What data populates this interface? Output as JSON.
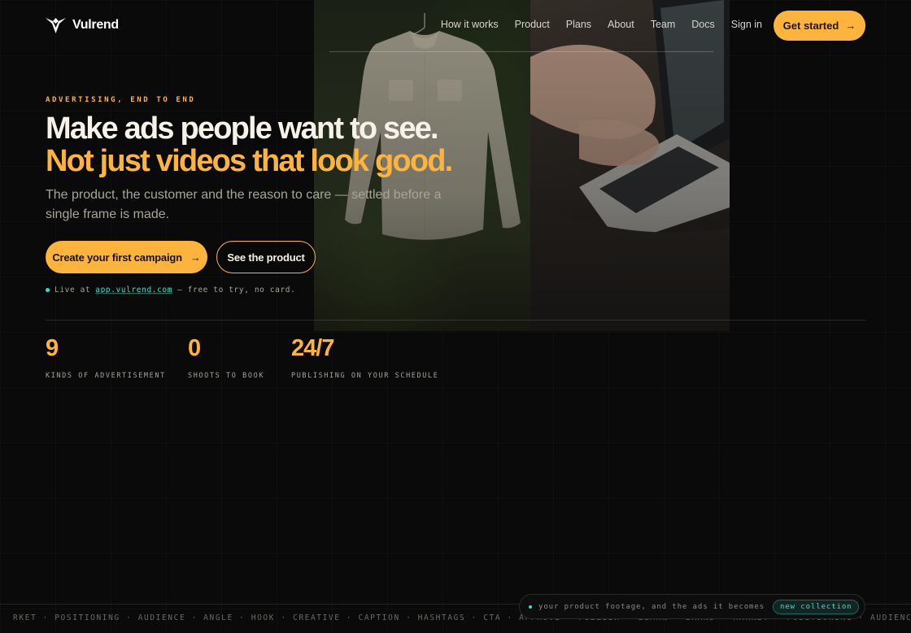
{
  "brand": {
    "name": "Vulrend",
    "logo_icon": "v-bird-logo"
  },
  "nav": {
    "links": [
      "How it works",
      "Product",
      "Plans",
      "About",
      "Team",
      "Docs",
      "Sign in"
    ],
    "cta_label": "Get started",
    "cta_icon": "arrow-right-icon"
  },
  "hero": {
    "eyebrow": "ADVERTISING, END TO END",
    "headline_line1": "Make ads people want to see.",
    "headline_line2": "Not just videos that look good.",
    "subtitle": "The product, the customer and the reason to care — settled before a single frame is made.",
    "primary_button": "Create your first campaign",
    "secondary_button": "See the product",
    "live_prefix": "Live at",
    "live_link": "app.vulrend.com",
    "live_suffix": "— free to try, no card."
  },
  "stats": [
    {
      "value": "9",
      "label": "KINDS OF ADVERTISEMENT"
    },
    {
      "value": "0",
      "label": "SHOOTS TO BOOK"
    },
    {
      "value": "24/7",
      "label": "PUBLISHING ON YOUR SCHEDULE"
    }
  ],
  "ticker": {
    "text": "RKET · POSITIONING · AUDIENCE · ANGLE · HOOK · CREATIVE · CAPTION · HASHTAGS · CTA · APPROVE · PUBLISH · LEARN · BRAND · MARKET · POSITIONING · AUDIENCE · ANGLE · HOOK"
  },
  "notice": {
    "text": "your product footage, and the ads it becomes",
    "badge": "new collection"
  },
  "colors": {
    "accent": "#fdb43c",
    "teal": "#35e0c6",
    "background": "#0a0a0a"
  }
}
